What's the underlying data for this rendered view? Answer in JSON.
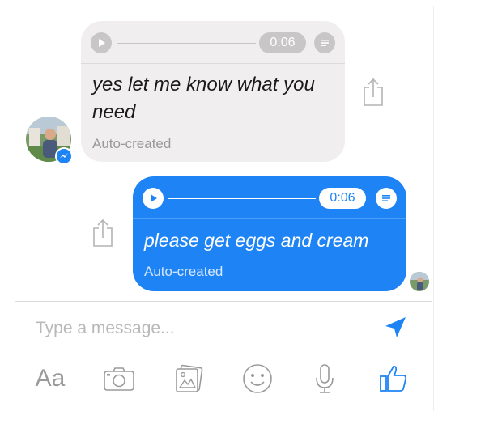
{
  "conversation": {
    "incoming": {
      "audio_duration": "0:06",
      "transcript": "yes let me know what you need",
      "auto_label": "Auto-created"
    },
    "outgoing": {
      "audio_duration": "0:06",
      "transcript": "please get eggs and cream",
      "auto_label": "Auto-created"
    }
  },
  "composer": {
    "placeholder": "Type a message..."
  },
  "toolbar": {
    "text_format_label": "Aa",
    "icons": [
      "camera-icon",
      "photo-gallery-icon",
      "emoji-icon",
      "microphone-icon",
      "thumbs-up-icon"
    ]
  },
  "colors": {
    "accent": "#1e84f5",
    "incoming_bubble": "#f0eeee",
    "icon_gray": "#9a9a9a"
  }
}
